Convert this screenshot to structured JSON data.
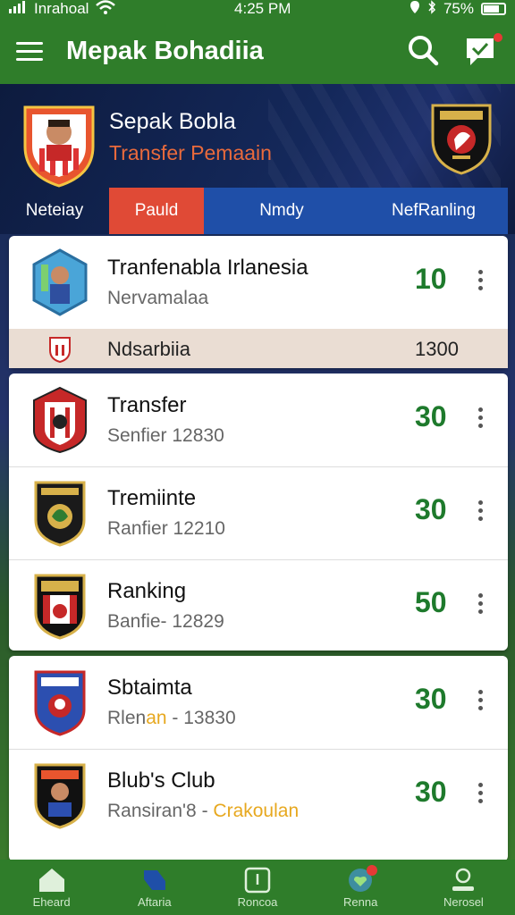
{
  "status_bar": {
    "carrier": "Inrahoal",
    "time": "4:25 PM",
    "battery": "75%"
  },
  "header": {
    "title": "Mepak Bohadiia",
    "search_icon": "search-icon",
    "notif_icon": "chat-notification-icon"
  },
  "hero": {
    "title": "Sepak Bobla",
    "subtitle": "Transfer Pemaain"
  },
  "tabs": [
    {
      "label": "Neteiay"
    },
    {
      "label": "Pauld"
    },
    {
      "label": "Nmdy"
    },
    {
      "label": "NefRanling"
    }
  ],
  "list": [
    {
      "title": "Tranfenabla Irlanesia",
      "subtitle": "Nervamalaa",
      "score": "10"
    },
    {
      "title": "Transfer",
      "subtitle": "Senfier 12830",
      "score": "30"
    },
    {
      "title": "Tremiinte",
      "subtitle": "Ranfier 12210",
      "score": "30"
    },
    {
      "title": "Ranking",
      "subtitle": "Banfie- 12829",
      "score": "50"
    },
    {
      "title": "Sbtaimta",
      "subtitle_pre": "Rlen",
      "subtitle_hl": "an",
      "subtitle_post": " - 13830",
      "score": "30"
    },
    {
      "title": "Blub's Club",
      "subtitle_pre": "Ransiran'8 - ",
      "subtitle_hl": "Crakoulan",
      "subtitle_post": "",
      "score": "30"
    }
  ],
  "sub_row": {
    "label": "Ndsarbiia",
    "value": "1300"
  },
  "nav": [
    {
      "label": "Eheard"
    },
    {
      "label": "Aftaria"
    },
    {
      "label": "Roncoa"
    },
    {
      "label": "Renna"
    },
    {
      "label": "Nerosel"
    }
  ],
  "colors": {
    "primary_green": "#2f7d2a",
    "accent_red": "#e04a36",
    "accent_blue": "#1f4fa8",
    "score_green": "#1e7a2c"
  }
}
